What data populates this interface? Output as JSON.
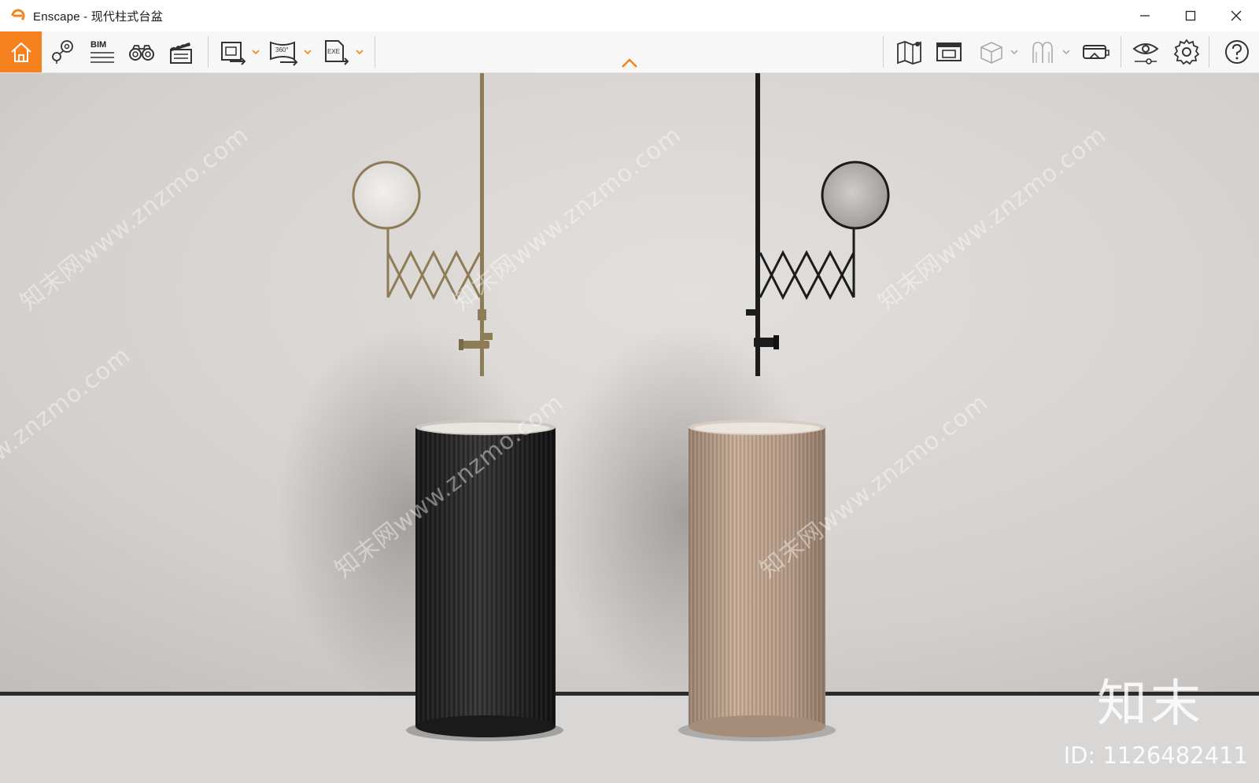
{
  "window": {
    "title": "Enscape - 现代柱式台盆",
    "controls": [
      "minimize-icon",
      "maximize-icon",
      "close-icon"
    ]
  },
  "toolbar": {
    "left_tools": [
      {
        "name": "home",
        "icon": "home-icon",
        "active": true
      },
      {
        "name": "views",
        "icon": "map-pin-icon"
      },
      {
        "name": "bim",
        "icon": "bim-icon",
        "label": "BIM"
      },
      {
        "name": "walk",
        "icon": "binoculars-icon"
      },
      {
        "name": "video",
        "icon": "clapperboard-icon"
      },
      {
        "name": "render-image",
        "icon": "image-export-icon"
      },
      {
        "name": "render-panorama",
        "icon": "panorama-export-icon",
        "label": "360°"
      },
      {
        "name": "export-exe",
        "icon": "exe-export-icon",
        "label": "EXE"
      }
    ],
    "right_tools": [
      {
        "name": "map",
        "icon": "map-icon"
      },
      {
        "name": "web-standalone",
        "icon": "web-export-icon"
      },
      {
        "name": "asset-library",
        "icon": "cube-icon"
      },
      {
        "name": "materials",
        "icon": "material-icon"
      },
      {
        "name": "vr",
        "icon": "vr-headset-icon"
      },
      {
        "name": "visual-settings",
        "icon": "eye-icon"
      },
      {
        "name": "settings",
        "icon": "gear-icon"
      },
      {
        "name": "help",
        "icon": "help-icon"
      }
    ],
    "accent_color": "#f5821f"
  },
  "viewport": {
    "watermark_text": "知末网www.znzmo.com",
    "brand_logo": "知末",
    "id_label": "ID: 1126482411"
  }
}
